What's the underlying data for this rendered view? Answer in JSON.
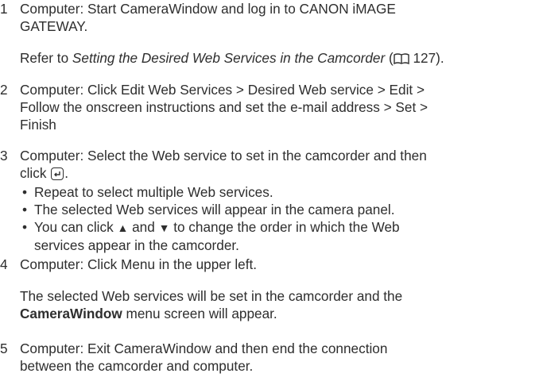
{
  "steps": [
    {
      "num": "1",
      "lines": [
        "Computer: Start CameraWindow and log in to CANON iMAGE",
        "GATEWAY."
      ],
      "note_prefix": "Refer to ",
      "note_link": "Setting the Desired Web Services in the Camcorder",
      "note_ref_open": " (",
      "note_ref_page": " 127)."
    },
    {
      "num": "2",
      "lines": [
        "Computer: Click Edit Web Services > Desired Web service > Edit >",
        "Follow the onscreen instructions and set the e-mail address > Set >",
        "Finish"
      ]
    },
    {
      "num": "3",
      "lines": [
        "Computer: Select the Web service to set in the camcorder and then"
      ],
      "line2_prefix": "click ",
      "line2_suffix": ".",
      "bullets": [
        "Repeat to select multiple Web services.",
        "The selected Web services will appear in the camera panel."
      ],
      "bullet3_a": "You can click ",
      "bullet3_up": "▲",
      "bullet3_and": " and ",
      "bullet3_down": "▼",
      "bullet3_b": " to change the order in which the Web",
      "bullet3_line2": "services appear in the camcorder."
    },
    {
      "num": "4",
      "lines": [
        "Computer: Click Menu in the upper left."
      ],
      "desc_line1": "The selected Web services will be set in the camcorder and the",
      "desc_bold": "CameraWindow",
      "desc_line2_rest": " menu screen will appear."
    },
    {
      "num": "5",
      "lines": [
        "Computer: Exit CameraWindow and then end the connection",
        "between the camcorder and computer."
      ]
    }
  ],
  "icons": {
    "enter": "enter-key-icon",
    "book": "book-reference-icon"
  }
}
